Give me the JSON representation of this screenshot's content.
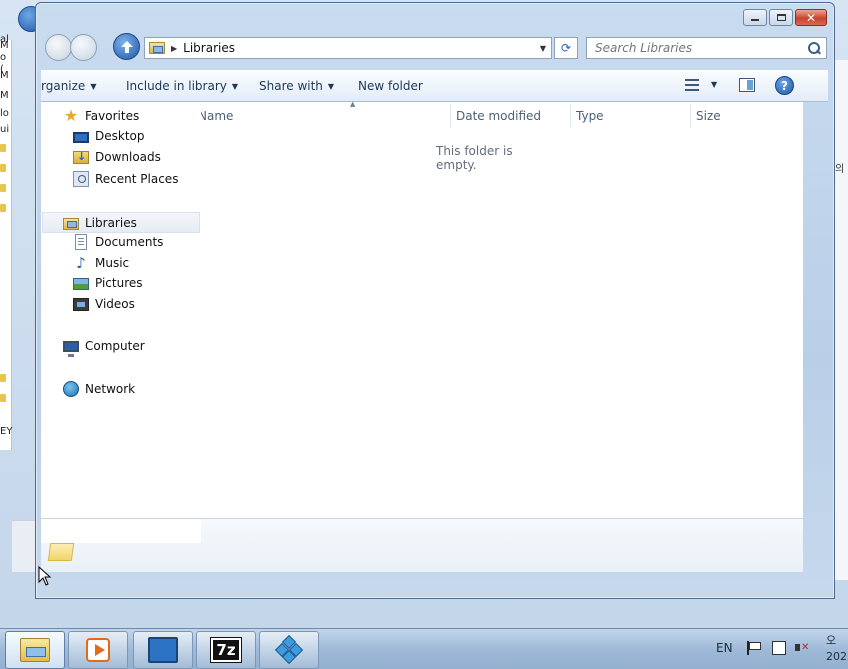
{
  "window": {
    "caption_buttons": [
      "minimize",
      "maximize",
      "close"
    ]
  },
  "address_bar": {
    "crumbs": [
      "Libraries"
    ],
    "search_placeholder": "Search Libraries"
  },
  "toolbar": {
    "organize_label": "rganize",
    "include_label": "Include in library",
    "share_label": "Share with",
    "new_folder_label": "New folder",
    "help_label": "?"
  },
  "nav_pane": {
    "favorites": {
      "label": "Favorites",
      "items": [
        "Desktop",
        "Downloads",
        "Recent Places"
      ]
    },
    "libraries": {
      "label": "Libraries",
      "items": [
        "Documents",
        "Music",
        "Pictures",
        "Videos"
      ]
    },
    "computer": {
      "label": "Computer"
    },
    "network": {
      "label": "Network"
    }
  },
  "columns": [
    "Name",
    "Date modified",
    "Type",
    "Size"
  ],
  "empty_message": "This folder is empty.",
  "background": {
    "left_fragments": [
      "M",
      "o (",
      "al",
      "M",
      "M",
      "lo",
      "ui",
      "EY"
    ],
    "right_fragment": "의"
  },
  "taskbar": {
    "apps": [
      "Windows Explorer",
      "Windows Media Player",
      "Remote Desktop",
      "7-Zip",
      "Registry Editor"
    ],
    "seven_zip_label": "7z",
    "language": "EN",
    "clock_line1": "오",
    "clock_line2": "202"
  },
  "colors": {
    "accent": "#2766b4",
    "close_button": "#c9452f"
  }
}
